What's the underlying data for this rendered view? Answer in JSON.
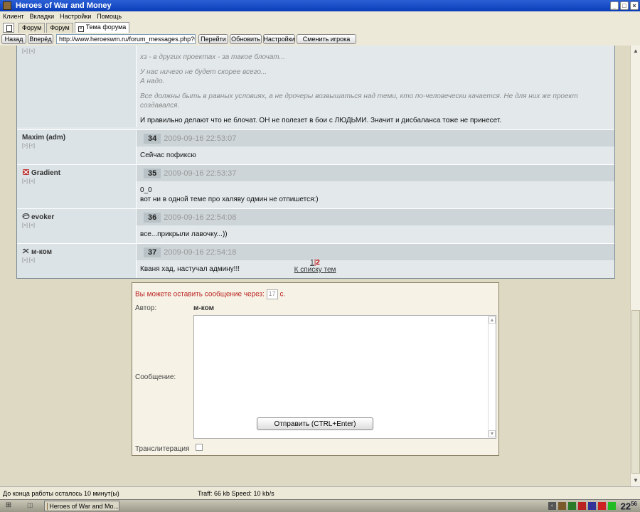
{
  "window": {
    "title": "Heroes of War and Money"
  },
  "menu": [
    "Клиент",
    "Вкладки",
    "Настройки",
    "Помощь"
  ],
  "tabs": [
    {
      "label": "Форум",
      "active": false
    },
    {
      "label": "Форум",
      "active": false
    },
    {
      "label": "Тема форума",
      "active": true
    }
  ],
  "nav": {
    "back": "Назад",
    "forward": "Вперёд",
    "url": "http://www.heroeswm.ru/forum_messages.php?tid=4078",
    "go": "Перейти",
    "refresh": "Обновить",
    "settings": "Настройки",
    "switch_player": "Сменить игрока"
  },
  "posts": [
    {
      "user": "",
      "links": "[>] [<]",
      "lines": [
        {
          "text": "хз - в других проектах - за такое блочат...",
          "quote": true
        },
        {
          "text": "У нас ничего не будет скорее всего...\nА надо.",
          "quote": true
        },
        {
          "text": "Все должны быть в равных условиях, а не дрочеры возвышаться над теми, кто по-человечески качается. Не для них же проект создавался.",
          "quote": true
        },
        {
          "text": "И правильно делают что не блочат. ОН не полезет в бои с ЛЮДЬМИ. Значит и дисбаланса тоже не принесет.",
          "quote": false
        }
      ]
    },
    {
      "user": "Maxim (adm)",
      "links": "[>] [<]",
      "num": "34",
      "time": "2009-09-16 22:53:07",
      "text": "Сейчас пофиксю"
    },
    {
      "user": "Gradient",
      "links": "[>] [<]",
      "num": "35",
      "time": "2009-09-16 22:53:37",
      "text": "0_0\nвот ни в одной теме про халяву одмин не отпишется:)"
    },
    {
      "user": "evoker",
      "links": "[>] [<]",
      "num": "36",
      "time": "2009-09-16 22:54:08",
      "text": "все...прикрыли лавочку...))"
    },
    {
      "user": "м-ком",
      "links": "[>] [<]",
      "num": "37",
      "time": "2009-09-16 22:54:18",
      "text": "Кваня хад, настучал админу!!!"
    }
  ],
  "pager": {
    "page1": "1",
    "sep": "|",
    "page2": "2",
    "back_to_list": "К списку тем"
  },
  "reply": {
    "wait_label": "Вы можете оставить сообщение через:",
    "wait_value": "17",
    "wait_unit": "с.",
    "author_label": "Автор:",
    "author_value": "м-ком",
    "message_label": "Сообщение:",
    "translit_label": "Транслитерация",
    "send": "Отправить (CTRL+Enter)"
  },
  "status": {
    "left": "До конца работы осталось 10 минут(ы)",
    "traffic": "Traff: 66 kb Speed: 10 kb/s"
  },
  "taskbar": {
    "item": "Heroes of War and Mo...",
    "clock_h": "22",
    "clock_m": "56"
  }
}
